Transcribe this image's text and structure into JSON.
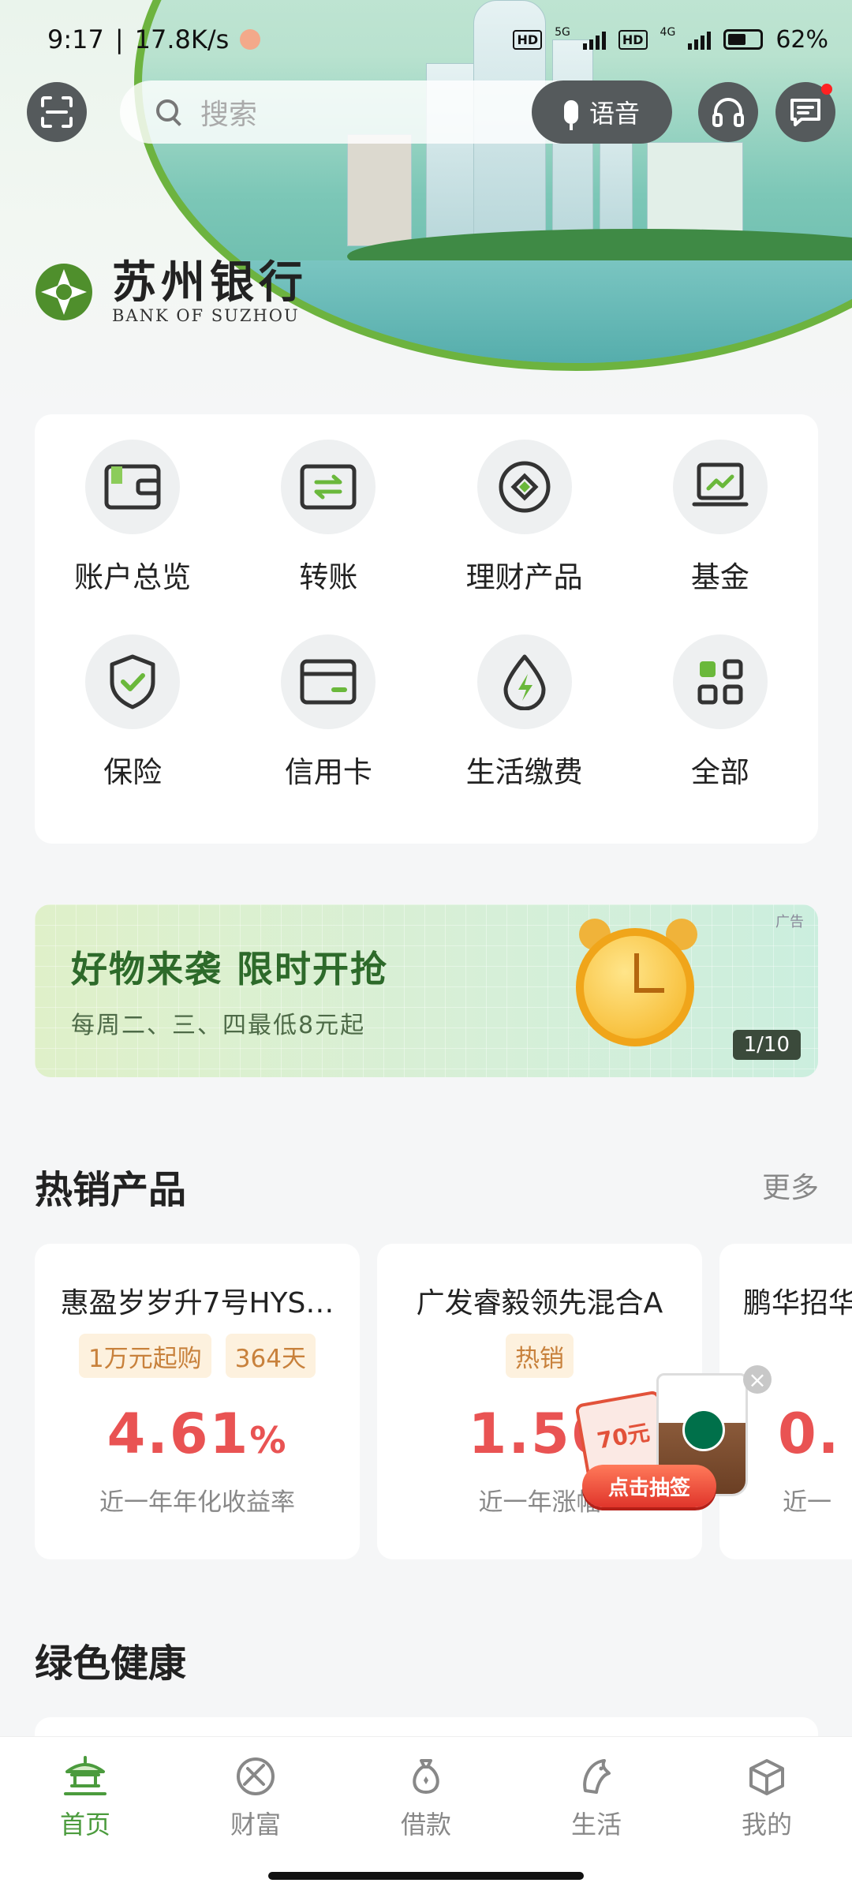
{
  "status_bar": {
    "time": "9:17",
    "separator": "|",
    "net_speed": "17.8K/s",
    "sim1_hd": "HD",
    "sim1_net": "5G",
    "sim2_hd": "HD",
    "sim2_net": "4G",
    "battery": "62%"
  },
  "header": {
    "search_placeholder": "搜索",
    "voice_label": "语音",
    "logo_cn": "苏州银行",
    "logo_en": "BANK OF SUZHOU"
  },
  "menu": {
    "items": [
      {
        "label": "账户总览",
        "icon": "wallet-icon"
      },
      {
        "label": "转账",
        "icon": "transfer-icon"
      },
      {
        "label": "理财产品",
        "icon": "wealth-product-icon"
      },
      {
        "label": "基金",
        "icon": "fund-chart-icon"
      },
      {
        "label": "保险",
        "icon": "insurance-shield-icon"
      },
      {
        "label": "信用卡",
        "icon": "credit-card-icon"
      },
      {
        "label": "生活缴费",
        "icon": "utility-bolt-icon"
      },
      {
        "label": "全部",
        "icon": "grid-all-icon"
      }
    ]
  },
  "banner": {
    "title": "好物来袭 限时开抢",
    "subtitle": "每周二、三、四最低8元起",
    "ad_label": "广告",
    "page_indicator": "1/10"
  },
  "hot_products": {
    "title": "热销产品",
    "more": "更多",
    "cards": [
      {
        "name": "惠盈岁岁升7号HYS…",
        "tags": [
          "1万元起购",
          "364天"
        ],
        "rate": "4.61",
        "unit": "%",
        "desc": "近一年年化收益率"
      },
      {
        "name": "广发睿毅领先混合A",
        "tags": [
          "热销"
        ],
        "rate": "1.56",
        "unit": "",
        "desc": "近一年涨幅"
      },
      {
        "name": "鹏华招华",
        "tags": [],
        "rate": "0.",
        "unit": "",
        "desc": "近一"
      }
    ]
  },
  "promo": {
    "ticket_text": "70元",
    "button_label": "点击抽签",
    "close": "×"
  },
  "green_section": {
    "title": "绿色健康"
  },
  "tabbar": {
    "items": [
      {
        "label": "首页",
        "active": true
      },
      {
        "label": "财富",
        "active": false
      },
      {
        "label": "借款",
        "active": false
      },
      {
        "label": "生活",
        "active": false
      },
      {
        "label": "我的",
        "active": false
      }
    ]
  },
  "colors": {
    "brand_green": "#4b9b3d",
    "rate_red": "#e95353",
    "tag_bg": "#fdf1de",
    "tag_text": "#c8813c"
  }
}
